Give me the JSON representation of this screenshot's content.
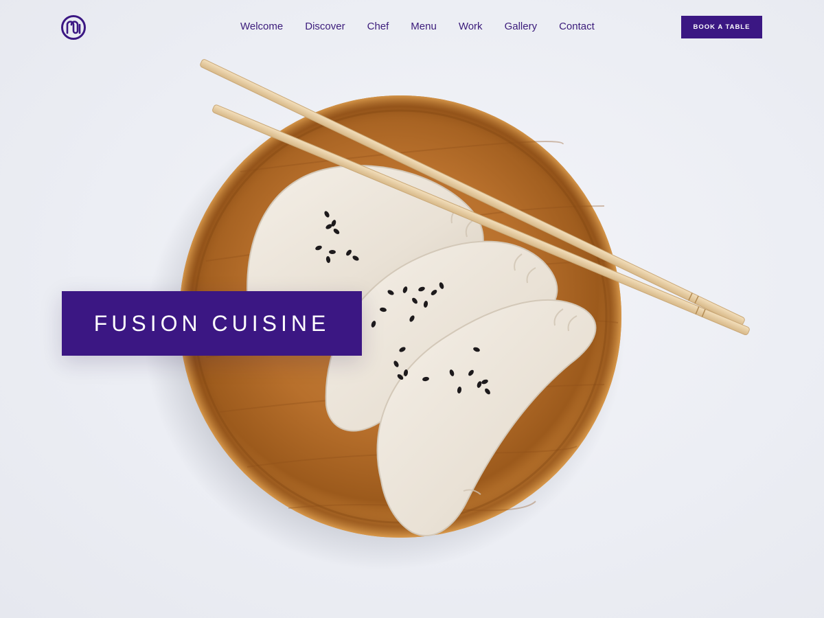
{
  "brand": {
    "logo_icon": "monogram-m-circle-icon",
    "accent_color": "#3b1783"
  },
  "nav": {
    "items": [
      "Welcome",
      "Discover",
      "Chef",
      "Menu",
      "Work",
      "Gallery",
      "Contact"
    ]
  },
  "header": {
    "cta_label": "BOOK A TABLE"
  },
  "hero": {
    "title": "FUSION CUISINE",
    "image": "dumplings-on-wooden-plate-with-chopsticks"
  }
}
